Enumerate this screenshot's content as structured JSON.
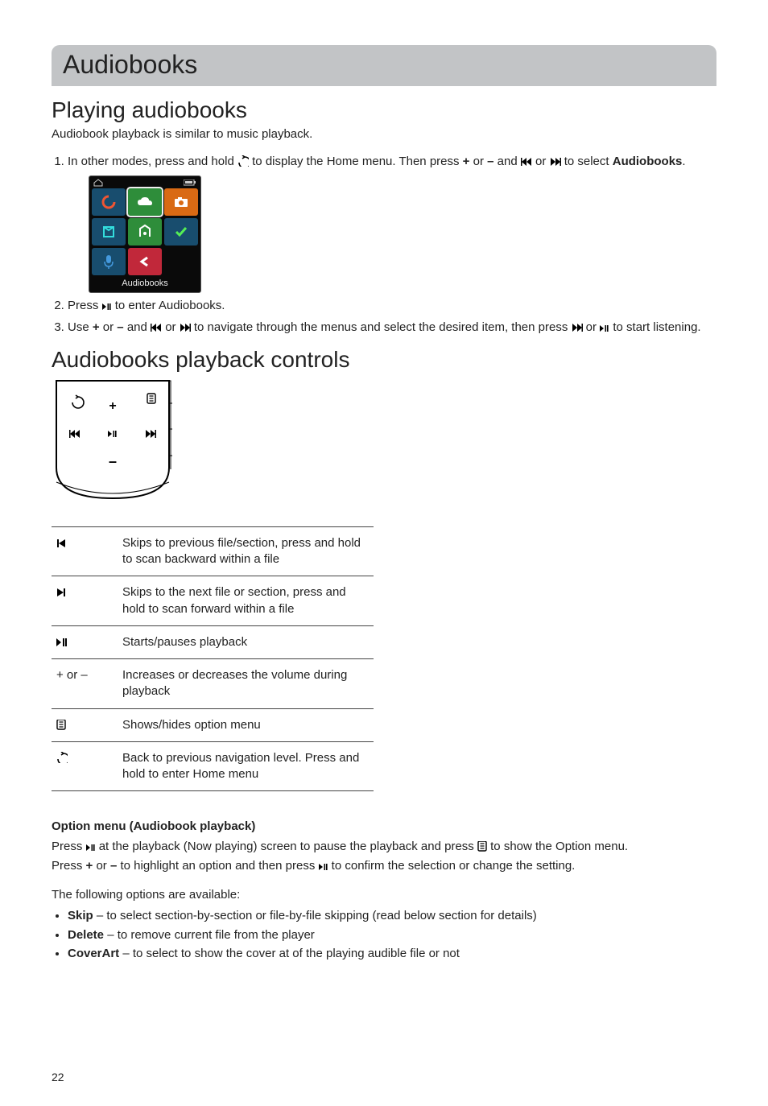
{
  "chapter": {
    "title": "Audiobooks"
  },
  "section1": {
    "title": "Playing audiobooks",
    "intro": "Audiobook playback is similar to music playback.",
    "step1_a": "In other modes, press and hold ",
    "step1_b": " to display the Home menu. Then press ",
    "step1_plus": "+",
    "step1_or1": " or ",
    "step1_minus": "–",
    "step1_and": " and ",
    "step1_or2": " or ",
    "step1_tosel": " to select ",
    "step1_target": "Audiobooks",
    "step1_period": ".",
    "home_menu_caption": "Audiobooks",
    "step2_a": "Press ",
    "step2_b": " to enter Audiobooks.",
    "step3_a": "Use  ",
    "step3_plus": "+",
    "step3_or1": " or ",
    "step3_minus": "–",
    "step3_and": " and ",
    "step3_or2": " or ",
    "step3_b": " to navigate through the menus and select the desired item, then press ",
    "step3_or3": " or ",
    "step3_c": " to start listening."
  },
  "section2": {
    "title": "Audiobooks playback controls",
    "rows": {
      "prev": "Skips to previous file/section, press and hold to scan backward within a file",
      "next": "Skips to the next file or section, press and hold to scan forward within a file",
      "play": "Starts/pauses playback",
      "vol_sym": "+ or –",
      "vol": "Increases or decreases the volume during playback",
      "menu": "Shows/hides option menu",
      "back": "Back to previous navigation level. Press and hold to enter Home menu"
    }
  },
  "option": {
    "heading": "Option menu (Audiobook playback)",
    "line1_a": "Press ",
    "line1_b": " at the playback (Now playing) screen to pause the playback and press ",
    "line1_c": " to show the Option menu.",
    "line2_a": "Press ",
    "line2_plus": "+",
    "line2_or": " or ",
    "line2_minus": "–",
    "line2_b": " to highlight an option and then press ",
    "line2_c": " to confirm the selection or change the setting.",
    "available": "The following options are available:",
    "items": {
      "skip_label": "Skip",
      "skip_desc": " – to select section-by-section or file-by-file skipping (read below section for details)",
      "delete_label": "Delete",
      "delete_desc": " – to remove current file from the player",
      "cover_label": "CoverArt",
      "cover_desc": " – to select to show the cover at of the playing audible file or not"
    }
  },
  "page_number": "22",
  "home_menu_colors": {
    "c1": "#184d6e",
    "c2": "#2e8d3a",
    "border2": "#eee",
    "c3": "#d96a14",
    "c4": "#184d6e",
    "c5": "#2e8d3a",
    "c6": "#184d6e",
    "c7": "#184d6e",
    "c8": "#c1283a"
  }
}
